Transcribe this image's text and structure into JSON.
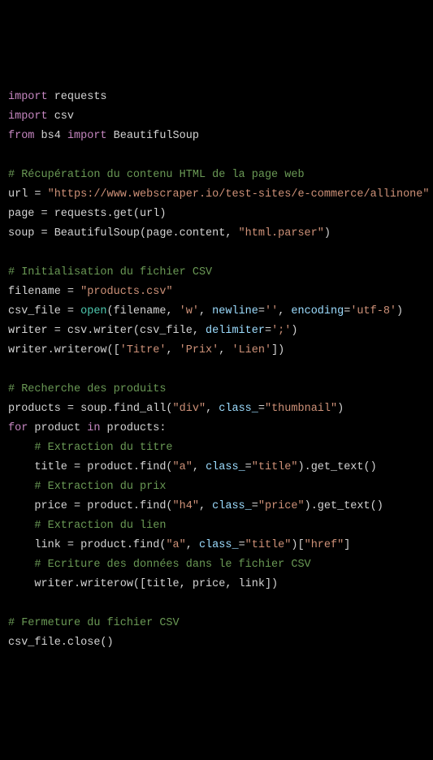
{
  "code": {
    "lines": [
      {
        "type": "code",
        "tokens": [
          {
            "t": "import",
            "c": "kw"
          },
          {
            "t": " requests",
            "c": "default"
          }
        ]
      },
      {
        "type": "code",
        "tokens": [
          {
            "t": "import",
            "c": "kw"
          },
          {
            "t": " csv",
            "c": "default"
          }
        ]
      },
      {
        "type": "code",
        "tokens": [
          {
            "t": "from",
            "c": "kw"
          },
          {
            "t": " bs4 ",
            "c": "default"
          },
          {
            "t": "import",
            "c": "kw"
          },
          {
            "t": " BeautifulSoup",
            "c": "default"
          }
        ]
      },
      {
        "type": "blank"
      },
      {
        "type": "code",
        "tokens": [
          {
            "t": "# Récupération du contenu HTML de la page web",
            "c": "com"
          }
        ]
      },
      {
        "type": "code",
        "tokens": [
          {
            "t": "url = ",
            "c": "default"
          },
          {
            "t": "\"https://www.webscraper.io/test-sites/e-commerce/allinone\"",
            "c": "str"
          }
        ]
      },
      {
        "type": "code",
        "tokens": [
          {
            "t": "page = requests.get(url)",
            "c": "default"
          }
        ]
      },
      {
        "type": "code",
        "tokens": [
          {
            "t": "soup = BeautifulSoup(page.content, ",
            "c": "default"
          },
          {
            "t": "\"html.parser\"",
            "c": "str"
          },
          {
            "t": ")",
            "c": "default"
          }
        ]
      },
      {
        "type": "blank"
      },
      {
        "type": "code",
        "tokens": [
          {
            "t": "# Initialisation du fichier CSV",
            "c": "com"
          }
        ]
      },
      {
        "type": "code",
        "tokens": [
          {
            "t": "filename = ",
            "c": "default"
          },
          {
            "t": "\"products.csv\"",
            "c": "str"
          }
        ]
      },
      {
        "type": "code",
        "tokens": [
          {
            "t": "csv_file = ",
            "c": "default"
          },
          {
            "t": "open",
            "c": "builtin"
          },
          {
            "t": "(filename, ",
            "c": "default"
          },
          {
            "t": "'w'",
            "c": "str"
          },
          {
            "t": ", ",
            "c": "default"
          },
          {
            "t": "newline",
            "c": "param"
          },
          {
            "t": "=",
            "c": "default"
          },
          {
            "t": "''",
            "c": "str"
          },
          {
            "t": ", ",
            "c": "default"
          },
          {
            "t": "encoding",
            "c": "param"
          },
          {
            "t": "=",
            "c": "default"
          },
          {
            "t": "'utf-8'",
            "c": "str"
          },
          {
            "t": ")",
            "c": "default"
          }
        ]
      },
      {
        "type": "code",
        "tokens": [
          {
            "t": "writer = csv.writer(csv_file, ",
            "c": "default"
          },
          {
            "t": "delimiter",
            "c": "param"
          },
          {
            "t": "=",
            "c": "default"
          },
          {
            "t": "';'",
            "c": "str"
          },
          {
            "t": ")",
            "c": "default"
          }
        ]
      },
      {
        "type": "code",
        "tokens": [
          {
            "t": "writer.writerow([",
            "c": "default"
          },
          {
            "t": "'Titre'",
            "c": "str"
          },
          {
            "t": ", ",
            "c": "default"
          },
          {
            "t": "'Prix'",
            "c": "str"
          },
          {
            "t": ", ",
            "c": "default"
          },
          {
            "t": "'Lien'",
            "c": "str"
          },
          {
            "t": "])",
            "c": "default"
          }
        ]
      },
      {
        "type": "blank"
      },
      {
        "type": "code",
        "tokens": [
          {
            "t": "# Recherche des produits",
            "c": "com"
          }
        ]
      },
      {
        "type": "code",
        "tokens": [
          {
            "t": "products = soup.find_all(",
            "c": "default"
          },
          {
            "t": "\"div\"",
            "c": "str"
          },
          {
            "t": ", ",
            "c": "default"
          },
          {
            "t": "class_",
            "c": "param"
          },
          {
            "t": "=",
            "c": "default"
          },
          {
            "t": "\"thumbnail\"",
            "c": "str"
          },
          {
            "t": ")",
            "c": "default"
          }
        ]
      },
      {
        "type": "code",
        "tokens": [
          {
            "t": "for",
            "c": "kw"
          },
          {
            "t": " product ",
            "c": "default"
          },
          {
            "t": "in",
            "c": "kw"
          },
          {
            "t": " products:",
            "c": "default"
          }
        ]
      },
      {
        "type": "code",
        "tokens": [
          {
            "t": "    ",
            "c": "default"
          },
          {
            "t": "# Extraction du titre",
            "c": "com"
          }
        ]
      },
      {
        "type": "code",
        "tokens": [
          {
            "t": "    title = product.find(",
            "c": "default"
          },
          {
            "t": "\"a\"",
            "c": "str"
          },
          {
            "t": ", ",
            "c": "default"
          },
          {
            "t": "class_",
            "c": "param"
          },
          {
            "t": "=",
            "c": "default"
          },
          {
            "t": "\"title\"",
            "c": "str"
          },
          {
            "t": ").get_text()",
            "c": "default"
          }
        ]
      },
      {
        "type": "code",
        "tokens": [
          {
            "t": "    ",
            "c": "default"
          },
          {
            "t": "# Extraction du prix",
            "c": "com"
          }
        ]
      },
      {
        "type": "code",
        "tokens": [
          {
            "t": "    price = product.find(",
            "c": "default"
          },
          {
            "t": "\"h4\"",
            "c": "str"
          },
          {
            "t": ", ",
            "c": "default"
          },
          {
            "t": "class_",
            "c": "param"
          },
          {
            "t": "=",
            "c": "default"
          },
          {
            "t": "\"price\"",
            "c": "str"
          },
          {
            "t": ").get_text()",
            "c": "default"
          }
        ]
      },
      {
        "type": "code",
        "tokens": [
          {
            "t": "    ",
            "c": "default"
          },
          {
            "t": "# Extraction du lien",
            "c": "com"
          }
        ]
      },
      {
        "type": "code",
        "tokens": [
          {
            "t": "    link = product.find(",
            "c": "default"
          },
          {
            "t": "\"a\"",
            "c": "str"
          },
          {
            "t": ", ",
            "c": "default"
          },
          {
            "t": "class_",
            "c": "param"
          },
          {
            "t": "=",
            "c": "default"
          },
          {
            "t": "\"title\"",
            "c": "str"
          },
          {
            "t": ")[",
            "c": "default"
          },
          {
            "t": "\"href\"",
            "c": "str"
          },
          {
            "t": "]",
            "c": "default"
          }
        ]
      },
      {
        "type": "code",
        "tokens": [
          {
            "t": "    ",
            "c": "default"
          },
          {
            "t": "# Ecriture des données dans le fichier CSV",
            "c": "com"
          }
        ]
      },
      {
        "type": "code",
        "tokens": [
          {
            "t": "    writer.writerow([title, price, link])",
            "c": "default"
          }
        ]
      },
      {
        "type": "blank"
      },
      {
        "type": "code",
        "tokens": [
          {
            "t": "# Fermeture du fichier CSV",
            "c": "com"
          }
        ]
      },
      {
        "type": "code",
        "tokens": [
          {
            "t": "csv_file.close()",
            "c": "default"
          }
        ]
      }
    ]
  }
}
